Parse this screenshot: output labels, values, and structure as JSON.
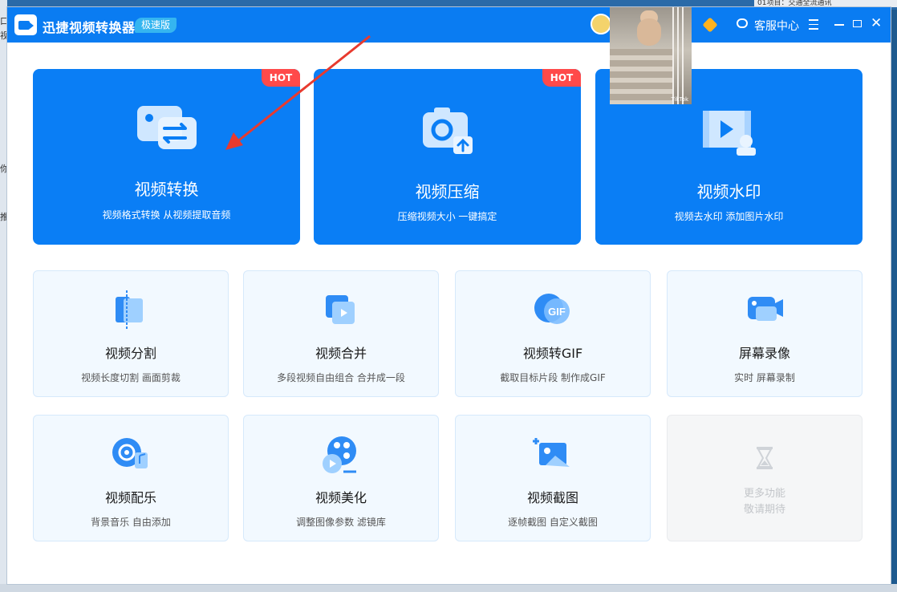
{
  "desktop": {
    "tray_text": "01项目：交通全流通讯",
    "left_fragments": [
      "口",
      "视",
      "你",
      "推"
    ]
  },
  "window": {
    "app_title": "迅捷视频转换器",
    "edition": "极速版",
    "service_label": "客服中心",
    "video_thumbnail_watermark": "TikTok"
  },
  "big_cards": [
    {
      "title": "视频转换",
      "subtitle": "视频格式转换 从视频提取音频",
      "tag": "HOT",
      "icon": "video-convert-icon"
    },
    {
      "title": "视频压缩",
      "subtitle": "压缩视频大小 一键搞定",
      "tag": "HOT",
      "icon": "video-compress-icon"
    },
    {
      "title": "视频水印",
      "subtitle": "视频去水印 添加图片水印",
      "tag": "",
      "icon": "video-watermark-icon"
    }
  ],
  "small_cards": [
    {
      "title": "视频分割",
      "subtitle": "视频长度切割 画面剪裁",
      "icon": "video-split-icon"
    },
    {
      "title": "视频合并",
      "subtitle": "多段视频自由组合 合并成一段",
      "icon": "video-merge-icon"
    },
    {
      "title": "视频转GIF",
      "subtitle": "截取目标片段 制作成GIF",
      "icon": "gif-icon",
      "icon_text": "GIF"
    },
    {
      "title": "屏幕录像",
      "subtitle": "实时 屏幕录制",
      "icon": "screen-record-icon"
    },
    {
      "title": "视频配乐",
      "subtitle": "背景音乐 自由添加",
      "icon": "video-music-icon"
    },
    {
      "title": "视频美化",
      "subtitle": "调整图像参数 滤镜库",
      "icon": "video-beautify-icon"
    },
    {
      "title": "视频截图",
      "subtitle": "逐帧截图 自定义截图",
      "icon": "video-screenshot-icon"
    },
    {
      "line1": "更多功能",
      "line2": "敬请期待",
      "icon": "hourglass-icon",
      "disabled": true
    }
  ],
  "colors": {
    "accent": "#0a7cf2",
    "hot": "#ff4a4a",
    "annotation_arrow": "#e83a2e"
  }
}
